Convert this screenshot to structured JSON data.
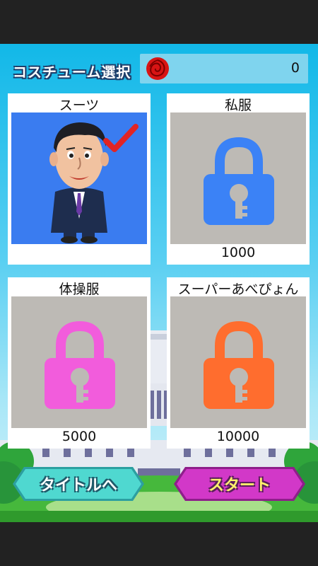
{
  "header": {
    "title": "コスチューム選択",
    "rose_count": "0"
  },
  "costumes": [
    {
      "name": "スーツ",
      "price": "",
      "locked": false,
      "selected": true
    },
    {
      "name": "私服",
      "price": "1000",
      "locked": true,
      "lock_color": "#3b82f6"
    },
    {
      "name": "体操服",
      "price": "5000",
      "locked": true,
      "lock_color": "#f25cdc"
    },
    {
      "name": "スーパーあべぴょん",
      "price": "10000",
      "locked": true,
      "lock_color": "#ff6d2e"
    }
  ],
  "buttons": {
    "title_label": "タイトルへ",
    "start_label": "スタート"
  },
  "colors": {
    "title_button": "#4fd8d0",
    "start_button": "#d238c8",
    "sky": "#12b8e8"
  }
}
